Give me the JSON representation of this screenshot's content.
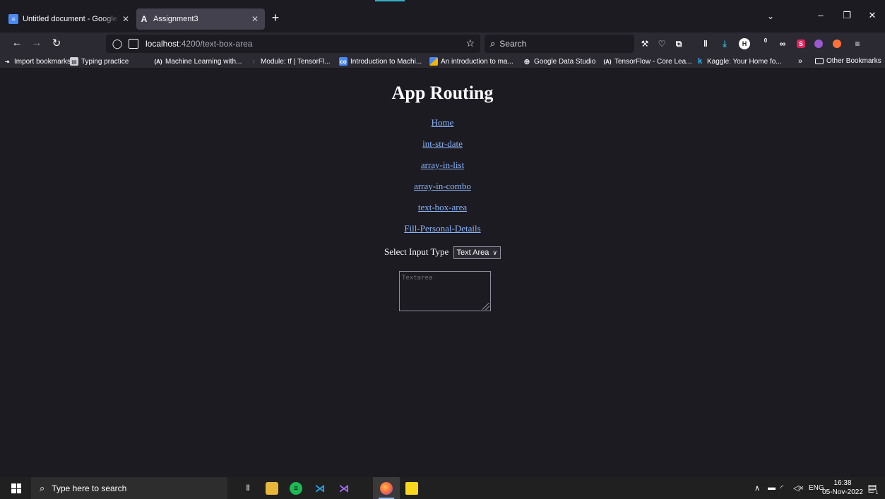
{
  "browser": {
    "tabs": [
      {
        "title": "Untitled document - Google Docs",
        "favicon": "docs-icon",
        "active": false
      },
      {
        "title": "Assignment3",
        "favicon": "angular-icon",
        "active": true
      }
    ],
    "new_tab_label": "+",
    "url": {
      "host": "localhost",
      "path": ":4200/text-box-area"
    },
    "search_placeholder": "Search",
    "bookmarks": [
      {
        "label": "Import bookmarks...",
        "icon": "import-icon",
        "color": "#fbfbfe"
      },
      {
        "label": "Typing practice",
        "icon": "typing-icon",
        "color": "#cfcfd8"
      },
      {
        "label": "Machine Learning with...",
        "icon": "a-icon",
        "color": "#fbfbfe"
      },
      {
        "label": "Module: tf | TensorFl...",
        "icon": "tensorflow-icon",
        "color": "#ff8f00"
      },
      {
        "label": "Introduction to Machi...",
        "icon": "colab-icon",
        "color": "#4a8af4"
      },
      {
        "label": "An introduction to ma...",
        "icon": "chart-icon",
        "color": "#4a8af4"
      },
      {
        "label": "Google Data Studio",
        "icon": "globe-icon",
        "color": "#fbfbfe"
      },
      {
        "label": "TensorFlow - Core Lea...",
        "icon": "a-icon",
        "color": "#fbfbfe"
      },
      {
        "label": "Kaggle: Your Home fo...",
        "icon": "kaggle-icon",
        "color": "#20beff"
      }
    ],
    "other_bookmarks": "Other Bookmarks",
    "toolbar_badge": "0"
  },
  "page": {
    "title": "App Routing",
    "links": [
      "Home",
      "int-str-date",
      "array-in-list",
      "array-in-combo",
      "text-box-area",
      "Fill-Personal-Details"
    ],
    "select_label": "Select Input Type",
    "select_value": "Text Area",
    "textarea_placeholder": "Textarea"
  },
  "taskbar": {
    "search_placeholder": "Type here to search",
    "language": "ENG",
    "time": "16:38",
    "date": "05-Nov-2022",
    "notification_count": "1"
  },
  "colors": {
    "link": "#8ab4f8",
    "background": "#1c1b22",
    "toolbar": "#2b2a33",
    "accent": "#33b0c8"
  }
}
